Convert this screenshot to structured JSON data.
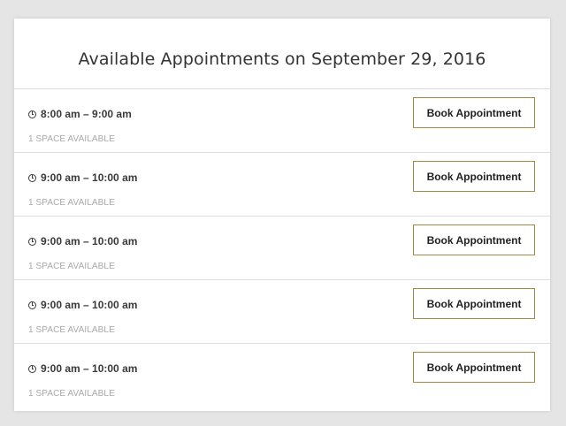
{
  "title": "Available Appointments on September 29, 2016",
  "slots": [
    {
      "time": "8:00 am – 9:00 am",
      "availability": "1 SPACE AVAILABLE",
      "button_label": "Book Appointment"
    },
    {
      "time": "9:00 am – 10:00 am",
      "availability": "1 SPACE AVAILABLE",
      "button_label": "Book Appointment"
    },
    {
      "time": "9:00 am – 10:00 am",
      "availability": "1 SPACE AVAILABLE",
      "button_label": "Book Appointment"
    },
    {
      "time": "9:00 am – 10:00 am",
      "availability": "1 SPACE AVAILABLE",
      "button_label": "Book Appointment"
    },
    {
      "time": "9:00 am – 10:00 am",
      "availability": "1 SPACE AVAILABLE",
      "button_label": "Book Appointment"
    }
  ],
  "icons": {
    "time": "clock-icon"
  },
  "colors": {
    "button_border": "#a08a45",
    "background": "#e5e5e5"
  }
}
